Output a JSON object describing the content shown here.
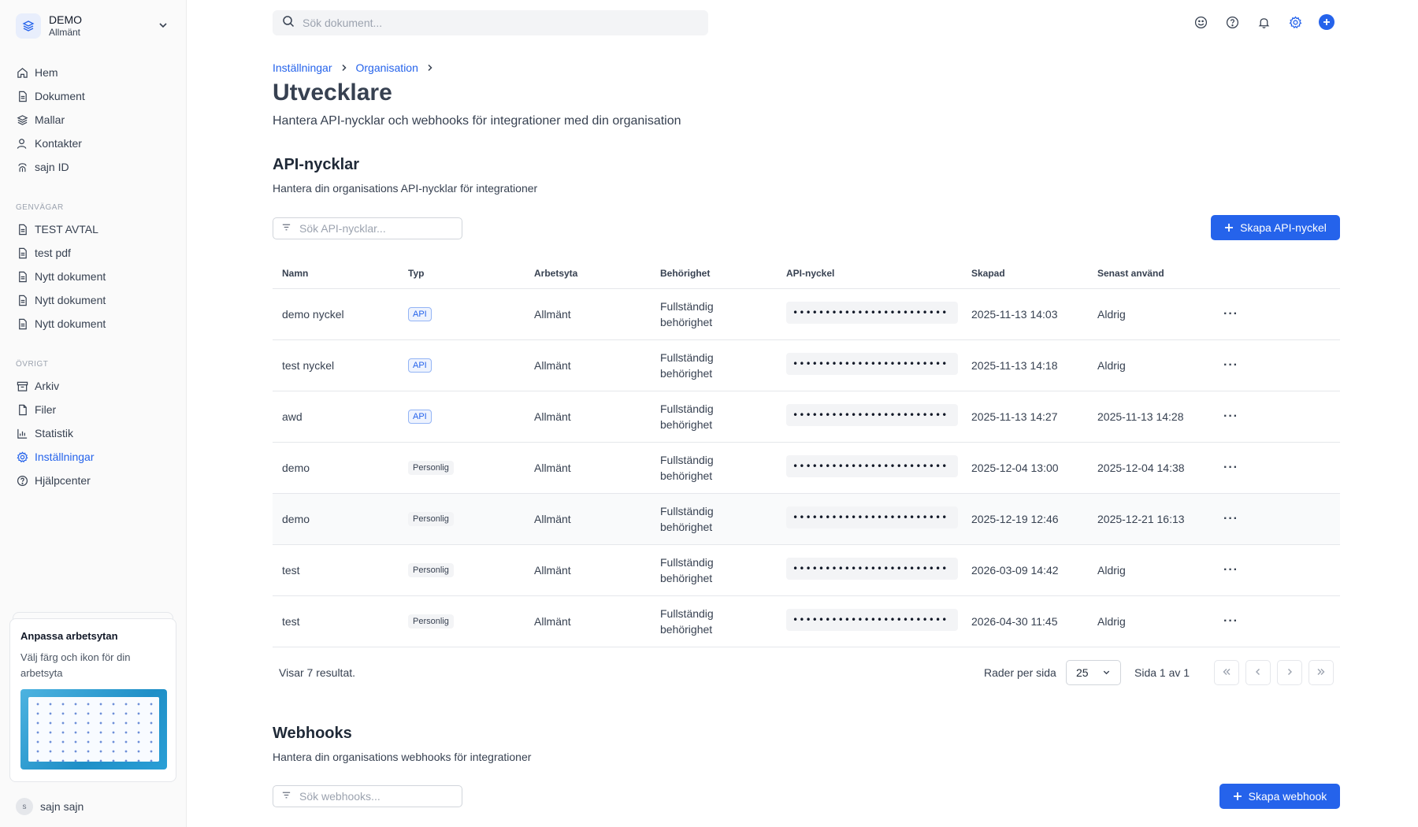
{
  "workspace": {
    "name": "DEMO",
    "sub": "Allmänt"
  },
  "nav": [
    {
      "label": "Hem",
      "icon": "home-icon"
    },
    {
      "label": "Dokument",
      "icon": "document-icon"
    },
    {
      "label": "Mallar",
      "icon": "layers-icon"
    },
    {
      "label": "Kontakter",
      "icon": "contacts-icon"
    },
    {
      "label": "sajn ID",
      "icon": "fingerprint-icon"
    }
  ],
  "shortcuts": {
    "label": "GENVÄGAR",
    "items": [
      "TEST AVTAL",
      "test pdf",
      "Nytt dokument",
      "Nytt dokument",
      "Nytt dokument"
    ]
  },
  "other": {
    "label": "ÖVRIGT",
    "items": [
      {
        "label": "Arkiv",
        "icon": "archive-icon"
      },
      {
        "label": "Filer",
        "icon": "file-icon"
      },
      {
        "label": "Statistik",
        "icon": "chart-icon"
      },
      {
        "label": "Inställningar",
        "icon": "gear-icon",
        "active": true
      },
      {
        "label": "Hjälpcenter",
        "icon": "help-icon"
      }
    ]
  },
  "promo": {
    "title": "Anpassa arbetsytan",
    "text": "Välj färg och ikon för din arbetsyta"
  },
  "user": {
    "initial": "s",
    "name": "sajn sajn"
  },
  "search": {
    "placeholder": "Sök dokument..."
  },
  "breadcrumb": [
    "Inställningar",
    "Organisation"
  ],
  "page": {
    "title": "Utvecklare",
    "subtitle": "Hantera API-nycklar och webhooks för integrationer med din organisation"
  },
  "api": {
    "title": "API-nycklar",
    "subtitle": "Hantera din organisations API-nycklar för integrationer",
    "filter_placeholder": "Sök API-nycklar...",
    "create_label": "Skapa API-nyckel",
    "columns": [
      "Namn",
      "Typ",
      "Arbetsyta",
      "Behörighet",
      "API-nyckel",
      "Skapad",
      "Senast använd"
    ],
    "rows": [
      {
        "name": "demo nyckel",
        "type": "API",
        "workspace": "Allmänt",
        "perm1": "Fullständig",
        "perm2": "behörighet",
        "key": "••••••••••••••••••••••••",
        "created": "2025-11-13 14:03",
        "last": "Aldrig"
      },
      {
        "name": "test nyckel",
        "type": "API",
        "workspace": "Allmänt",
        "perm1": "Fullständig",
        "perm2": "behörighet",
        "key": "••••••••••••••••••••••••",
        "created": "2025-11-13 14:18",
        "last": "Aldrig"
      },
      {
        "name": "awd",
        "type": "API",
        "workspace": "Allmänt",
        "perm1": "Fullständig",
        "perm2": "behörighet",
        "key": "••••••••••••••••••••••••",
        "created": "2025-11-13 14:27",
        "last": "2025-11-13 14:28"
      },
      {
        "name": "demo",
        "type": "Personlig",
        "workspace": "Allmänt",
        "perm1": "Fullständig",
        "perm2": "behörighet",
        "key": "••••••••••••••••••••••••",
        "created": "2025-12-04 13:00",
        "last": "2025-12-04 14:38"
      },
      {
        "name": "demo",
        "type": "Personlig",
        "workspace": "Allmänt",
        "perm1": "Fullständig",
        "perm2": "behörighet",
        "key": "••••••••••••••••••••••••",
        "created": "2025-12-19 12:46",
        "last": "2025-12-21 16:13"
      },
      {
        "name": "test",
        "type": "Personlig",
        "workspace": "Allmänt",
        "perm1": "Fullständig",
        "perm2": "behörighet",
        "key": "••••••••••••••••••••••••",
        "created": "2026-03-09 14:42",
        "last": "Aldrig"
      },
      {
        "name": "test",
        "type": "Personlig",
        "workspace": "Allmänt",
        "perm1": "Fullständig",
        "perm2": "behörighet",
        "key": "••••••••••••••••••••••••",
        "created": "2026-04-30 11:45",
        "last": "Aldrig"
      }
    ],
    "results": "Visar 7 resultat.",
    "rows_per_page_label": "Rader per sida",
    "rows_per_page": "25",
    "page_label": "Sida 1 av 1"
  },
  "webhooks": {
    "title": "Webhooks",
    "subtitle": "Hantera din organisations webhooks för integrationer",
    "filter_placeholder": "Sök webhooks...",
    "create_label": "Skapa webhook"
  },
  "colors": {
    "accent": "#2563eb"
  }
}
